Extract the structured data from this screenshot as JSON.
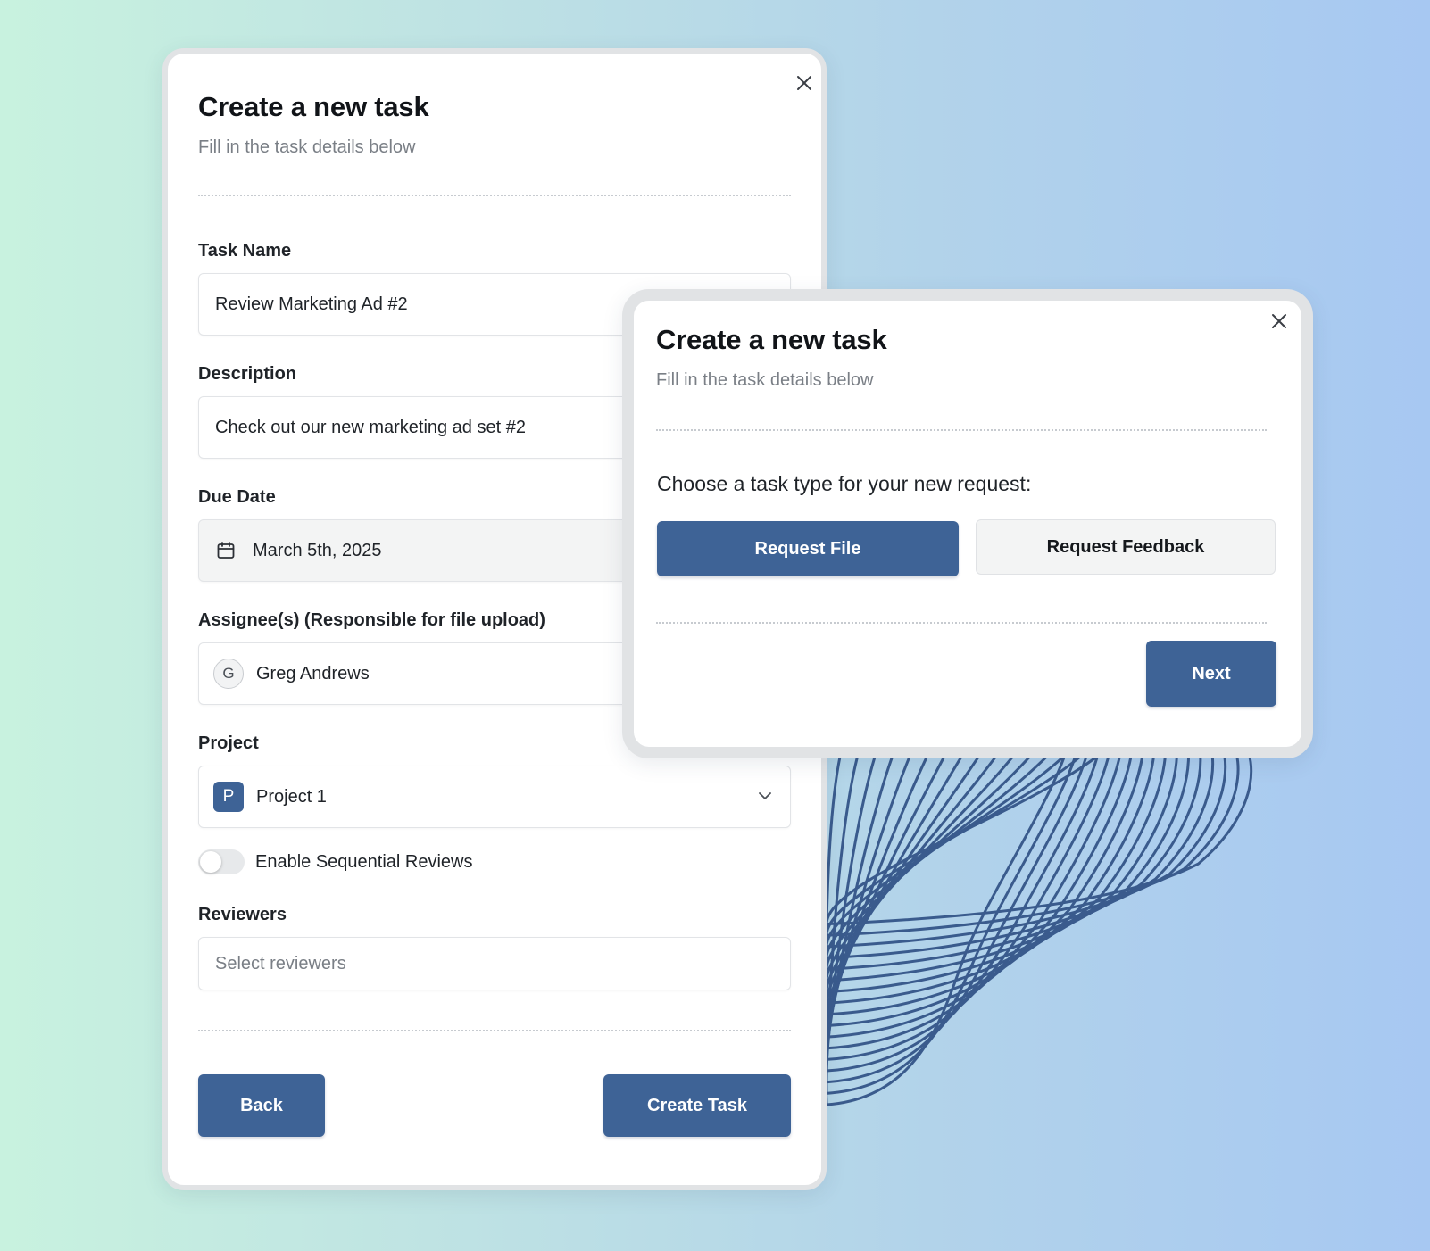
{
  "task_form": {
    "title": "Create a new task",
    "subtitle": "Fill in the task details below",
    "task_name": {
      "label": "Task Name",
      "value": "Review Marketing Ad #2"
    },
    "description": {
      "label": "Description",
      "value": "Check out our new marketing ad set #2"
    },
    "due_date": {
      "label": "Due Date",
      "value": "March 5th, 2025",
      "icon": "calendar-icon"
    },
    "assignees": {
      "label": "Assignee(s) (Responsible for file upload)",
      "avatar_initial": "G",
      "value": "Greg Andrews"
    },
    "project": {
      "label": "Project",
      "badge_initial": "P",
      "value": "Project 1",
      "icon": "chevron-down-icon"
    },
    "sequential_reviews": {
      "label": "Enable Sequential Reviews",
      "enabled": false
    },
    "reviewers": {
      "label": "Reviewers",
      "placeholder": "Select reviewers"
    },
    "back_label": "Back",
    "create_label": "Create Task"
  },
  "task_type_dialog": {
    "title": "Create a new task",
    "subtitle": "Fill in the task details below",
    "question": "Choose a task type for your new request:",
    "option_file": "Request File",
    "option_feedback": "Request Feedback",
    "next_label": "Next"
  },
  "colors": {
    "primary": "#3e6396",
    "wave_stroke": "#3a5b8d",
    "gradient_left": "#c8f2df",
    "gradient_right": "#a7c8f2"
  }
}
